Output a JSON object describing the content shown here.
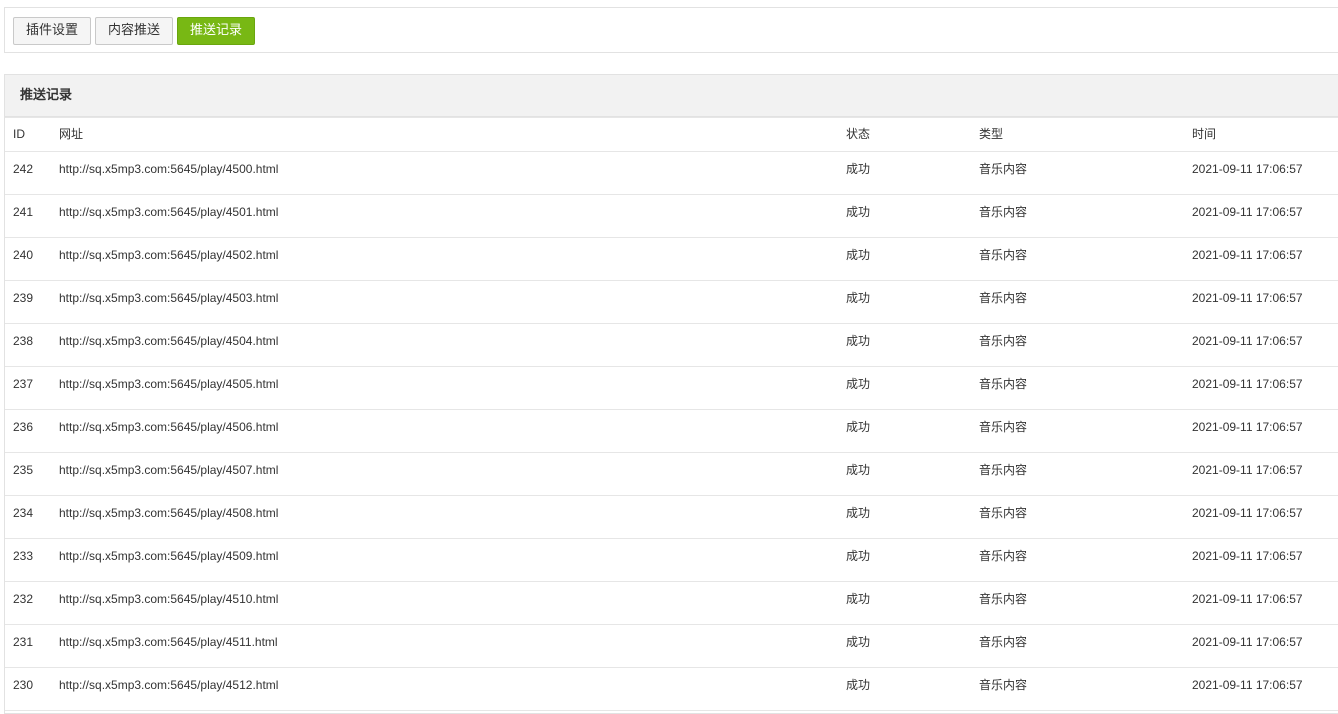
{
  "tabs": [
    {
      "label": "插件设置",
      "active": false
    },
    {
      "label": "内容推送",
      "active": false
    },
    {
      "label": "推送记录",
      "active": true
    }
  ],
  "colors": {
    "accent": "#78b814",
    "header_bg": "#f2f2f2",
    "border": "#e2e2e2"
  },
  "panel": {
    "title": "推送记录"
  },
  "table": {
    "columns": [
      "ID",
      "网址",
      "状态",
      "类型",
      "时间"
    ],
    "rows": [
      {
        "id": "242",
        "url": "http://sq.x5mp3.com:5645/play/4500.html",
        "status": "成功",
        "type": "音乐内容",
        "time": "2021-09-11 17:06:57"
      },
      {
        "id": "241",
        "url": "http://sq.x5mp3.com:5645/play/4501.html",
        "status": "成功",
        "type": "音乐内容",
        "time": "2021-09-11 17:06:57"
      },
      {
        "id": "240",
        "url": "http://sq.x5mp3.com:5645/play/4502.html",
        "status": "成功",
        "type": "音乐内容",
        "time": "2021-09-11 17:06:57"
      },
      {
        "id": "239",
        "url": "http://sq.x5mp3.com:5645/play/4503.html",
        "status": "成功",
        "type": "音乐内容",
        "time": "2021-09-11 17:06:57"
      },
      {
        "id": "238",
        "url": "http://sq.x5mp3.com:5645/play/4504.html",
        "status": "成功",
        "type": "音乐内容",
        "time": "2021-09-11 17:06:57"
      },
      {
        "id": "237",
        "url": "http://sq.x5mp3.com:5645/play/4505.html",
        "status": "成功",
        "type": "音乐内容",
        "time": "2021-09-11 17:06:57"
      },
      {
        "id": "236",
        "url": "http://sq.x5mp3.com:5645/play/4506.html",
        "status": "成功",
        "type": "音乐内容",
        "time": "2021-09-11 17:06:57"
      },
      {
        "id": "235",
        "url": "http://sq.x5mp3.com:5645/play/4507.html",
        "status": "成功",
        "type": "音乐内容",
        "time": "2021-09-11 17:06:57"
      },
      {
        "id": "234",
        "url": "http://sq.x5mp3.com:5645/play/4508.html",
        "status": "成功",
        "type": "音乐内容",
        "time": "2021-09-11 17:06:57"
      },
      {
        "id": "233",
        "url": "http://sq.x5mp3.com:5645/play/4509.html",
        "status": "成功",
        "type": "音乐内容",
        "time": "2021-09-11 17:06:57"
      },
      {
        "id": "232",
        "url": "http://sq.x5mp3.com:5645/play/4510.html",
        "status": "成功",
        "type": "音乐内容",
        "time": "2021-09-11 17:06:57"
      },
      {
        "id": "231",
        "url": "http://sq.x5mp3.com:5645/play/4511.html",
        "status": "成功",
        "type": "音乐内容",
        "time": "2021-09-11 17:06:57"
      },
      {
        "id": "230",
        "url": "http://sq.x5mp3.com:5645/play/4512.html",
        "status": "成功",
        "type": "音乐内容",
        "time": "2021-09-11 17:06:57"
      }
    ]
  }
}
